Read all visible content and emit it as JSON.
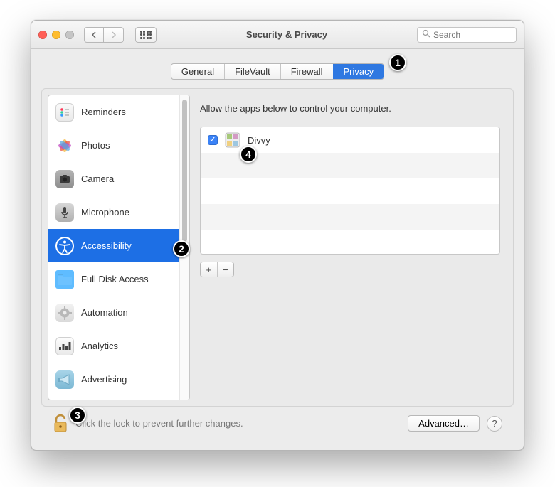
{
  "title": "Security & Privacy",
  "toolbar": {
    "search_placeholder": "Search"
  },
  "tabs": {
    "general": "General",
    "filevault": "FileVault",
    "firewall": "Firewall",
    "privacy": "Privacy"
  },
  "sidebar": {
    "items": [
      {
        "label": "Reminders"
      },
      {
        "label": "Photos"
      },
      {
        "label": "Camera"
      },
      {
        "label": "Microphone"
      },
      {
        "label": "Accessibility",
        "selected": true
      },
      {
        "label": "Full Disk Access"
      },
      {
        "label": "Automation"
      },
      {
        "label": "Analytics"
      },
      {
        "label": "Advertising"
      }
    ]
  },
  "main": {
    "header": "Allow the apps below to control your computer.",
    "apps": [
      {
        "name": "Divvy",
        "checked": true
      }
    ],
    "add": "+",
    "remove": "−"
  },
  "footer": {
    "lock_text": "Click the lock to prevent further changes.",
    "advanced": "Advanced…",
    "help": "?"
  },
  "annotations": [
    "1",
    "2",
    "3",
    "4"
  ]
}
